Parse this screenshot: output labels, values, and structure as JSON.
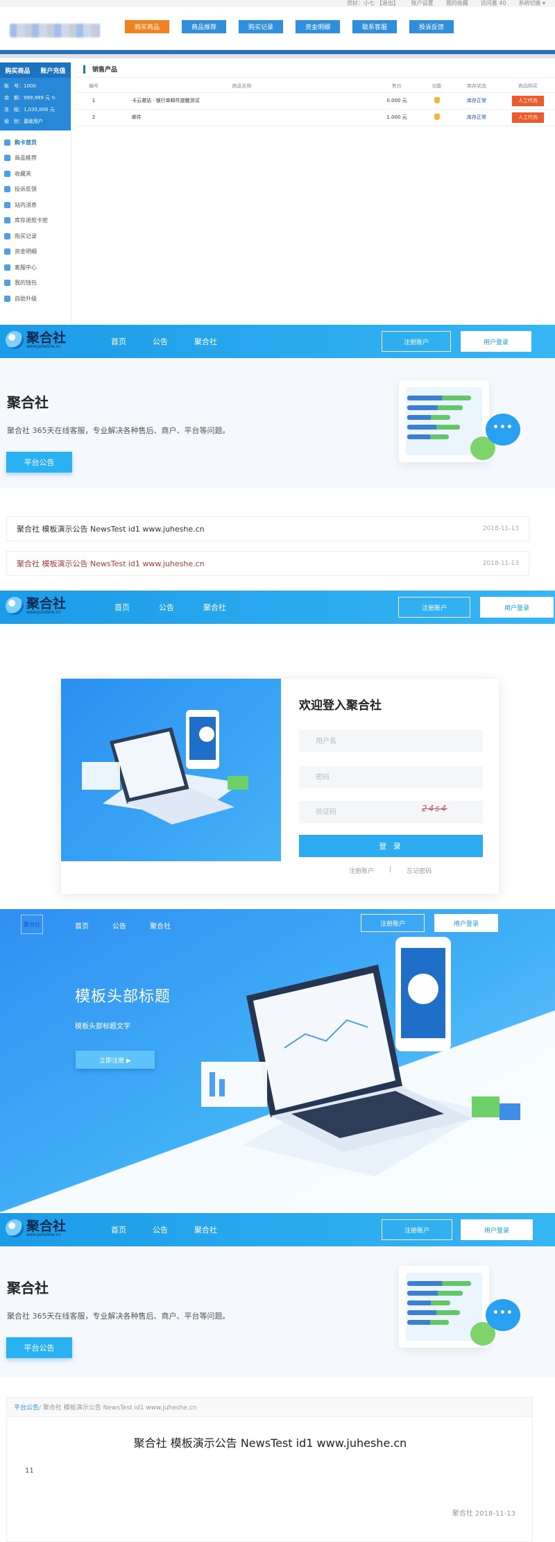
{
  "admin": {
    "topbar": [
      "您好：小七 【退出】",
      "账户设置",
      "我的收藏",
      "访问量 40",
      "系统切换 ▾"
    ],
    "nav": [
      "购买商品",
      "商品推荐",
      "购买记录",
      "资金明细",
      "联系客服",
      "投诉反馈"
    ],
    "side_tabs": [
      "购买商品",
      "账户充值"
    ],
    "info": [
      {
        "k": "账　号：",
        "v": "1000"
      },
      {
        "k": "余　额：",
        "v": "999,999 元"
      },
      {
        "k": "冻　结：",
        "v": "1,035,000 元"
      },
      {
        "k": "级　别：",
        "v": "基础用户"
      }
    ],
    "menu": [
      "购卡首页",
      "商品推荐",
      "收藏夹",
      "投诉反馈",
      "站内消息",
      "库存退款卡密",
      "购买记录",
      "资金明细",
      "客服中心",
      "我的钱包",
      "自助升级"
    ],
    "panel_title": "销售产品",
    "columns": [
      "编号",
      "商品名称",
      "售价",
      "功能",
      "库存状态",
      "商品购买"
    ],
    "rows": [
      {
        "id": "1",
        "name": "卡云邀站 · 银行单邮件提醒测试",
        "price": "0.000 元",
        "stock": "库存正常",
        "buy": "人工代充"
      },
      {
        "id": "2",
        "name": "邮件",
        "price": "1.000 元",
        "stock": "库存正常",
        "buy": "人工代充"
      }
    ]
  },
  "site": {
    "logo": "聚合社",
    "logo_sub": "www.JuheShe.cn",
    "links": [
      "首页",
      "公告",
      "聚合社"
    ],
    "register": "注册账户",
    "login": "用户登录"
  },
  "hero": {
    "title": "聚合社",
    "desc": "聚合社 365天在线客服，专业解决各种售后、商户、平台等问题。",
    "button": "平台公告"
  },
  "news": [
    {
      "title": "聚合社 模板演示公告 NewsTest id1 www.juheshe.cn",
      "date": "2018-11-13",
      "color": "#333333"
    },
    {
      "title": "聚合社 模板演示公告 NewsTest id1 www.juheshe.cn",
      "date": "2018-11-13",
      "color": "#b23a3a"
    }
  ],
  "login": {
    "title": "欢迎登入聚合社",
    "user_ph": "用户名",
    "pass_ph": "密码",
    "code_ph": "验证码",
    "captcha": "24s4",
    "submit": "登 录",
    "reg_link": "注册账户",
    "sep": "|",
    "forgot_link": "忘记密码"
  },
  "banner": {
    "brand": "聚合社",
    "links": [
      "首页",
      "公告",
      "聚合社"
    ],
    "register": "注册账户",
    "login": "用户登录",
    "title": "模板头部标题",
    "sub": "模板头部标题文字",
    "button": "立即注册 ▶"
  },
  "detail": {
    "crumb_home": "平台公告",
    "crumb_rest": " / 聚合社 模板演示公告 NewsTest id1 www.juheshe.cn",
    "title": "聚合社 模板演示公告 NewsTest id1 www.juheshe.cn",
    "body": "11",
    "footer": "聚合社 2018-11-13"
  },
  "colors": {
    "primary": "#1c9be8",
    "orange": "#f0831f",
    "danger": "#ef5a2a"
  }
}
